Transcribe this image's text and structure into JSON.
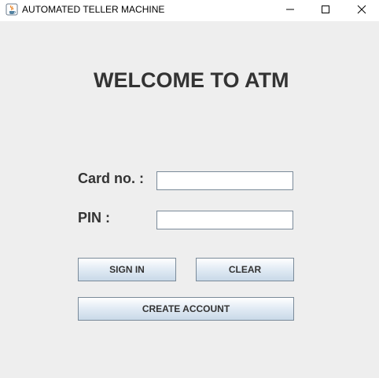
{
  "window": {
    "title": "AUTOMATED TELLER MACHINE",
    "app_icon": "java-cup-icon",
    "controls": {
      "minimize": "minimize-icon",
      "maximize": "maximize-icon",
      "close": "close-icon"
    }
  },
  "main": {
    "heading": "WELCOME TO ATM",
    "card_label": "Card no. :",
    "card_value": "",
    "pin_label": "PIN :",
    "pin_value": ""
  },
  "buttons": {
    "signin": "SIGN IN",
    "clear": "CLEAR",
    "create": "CREATE ACCOUNT"
  },
  "colors": {
    "background": "#eeeeee",
    "text": "#333333",
    "button_top": "#ffffff",
    "button_bottom": "#c9d9e8",
    "border": "#7a8a99"
  }
}
